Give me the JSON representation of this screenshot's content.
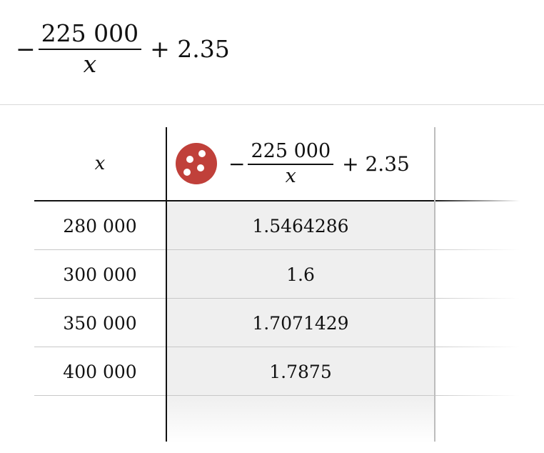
{
  "expression": {
    "minus": "−",
    "numerator": "225 000",
    "denominator": "x",
    "plus_term": "+ 2.35"
  },
  "table": {
    "header": {
      "x_label": "x",
      "y_expression": {
        "minus": "−",
        "numerator": "225 000",
        "denominator": "x",
        "plus_term": "+ 2.35"
      },
      "icon": "dice-icon",
      "icon_color": "#c0403a"
    },
    "rows": [
      {
        "x": "280 000",
        "y": "1.5464286"
      },
      {
        "x": "300 000",
        "y": "1.6"
      },
      {
        "x": "350 000",
        "y": "1.7071429"
      },
      {
        "x": "400 000",
        "y": "1.7875"
      }
    ]
  }
}
